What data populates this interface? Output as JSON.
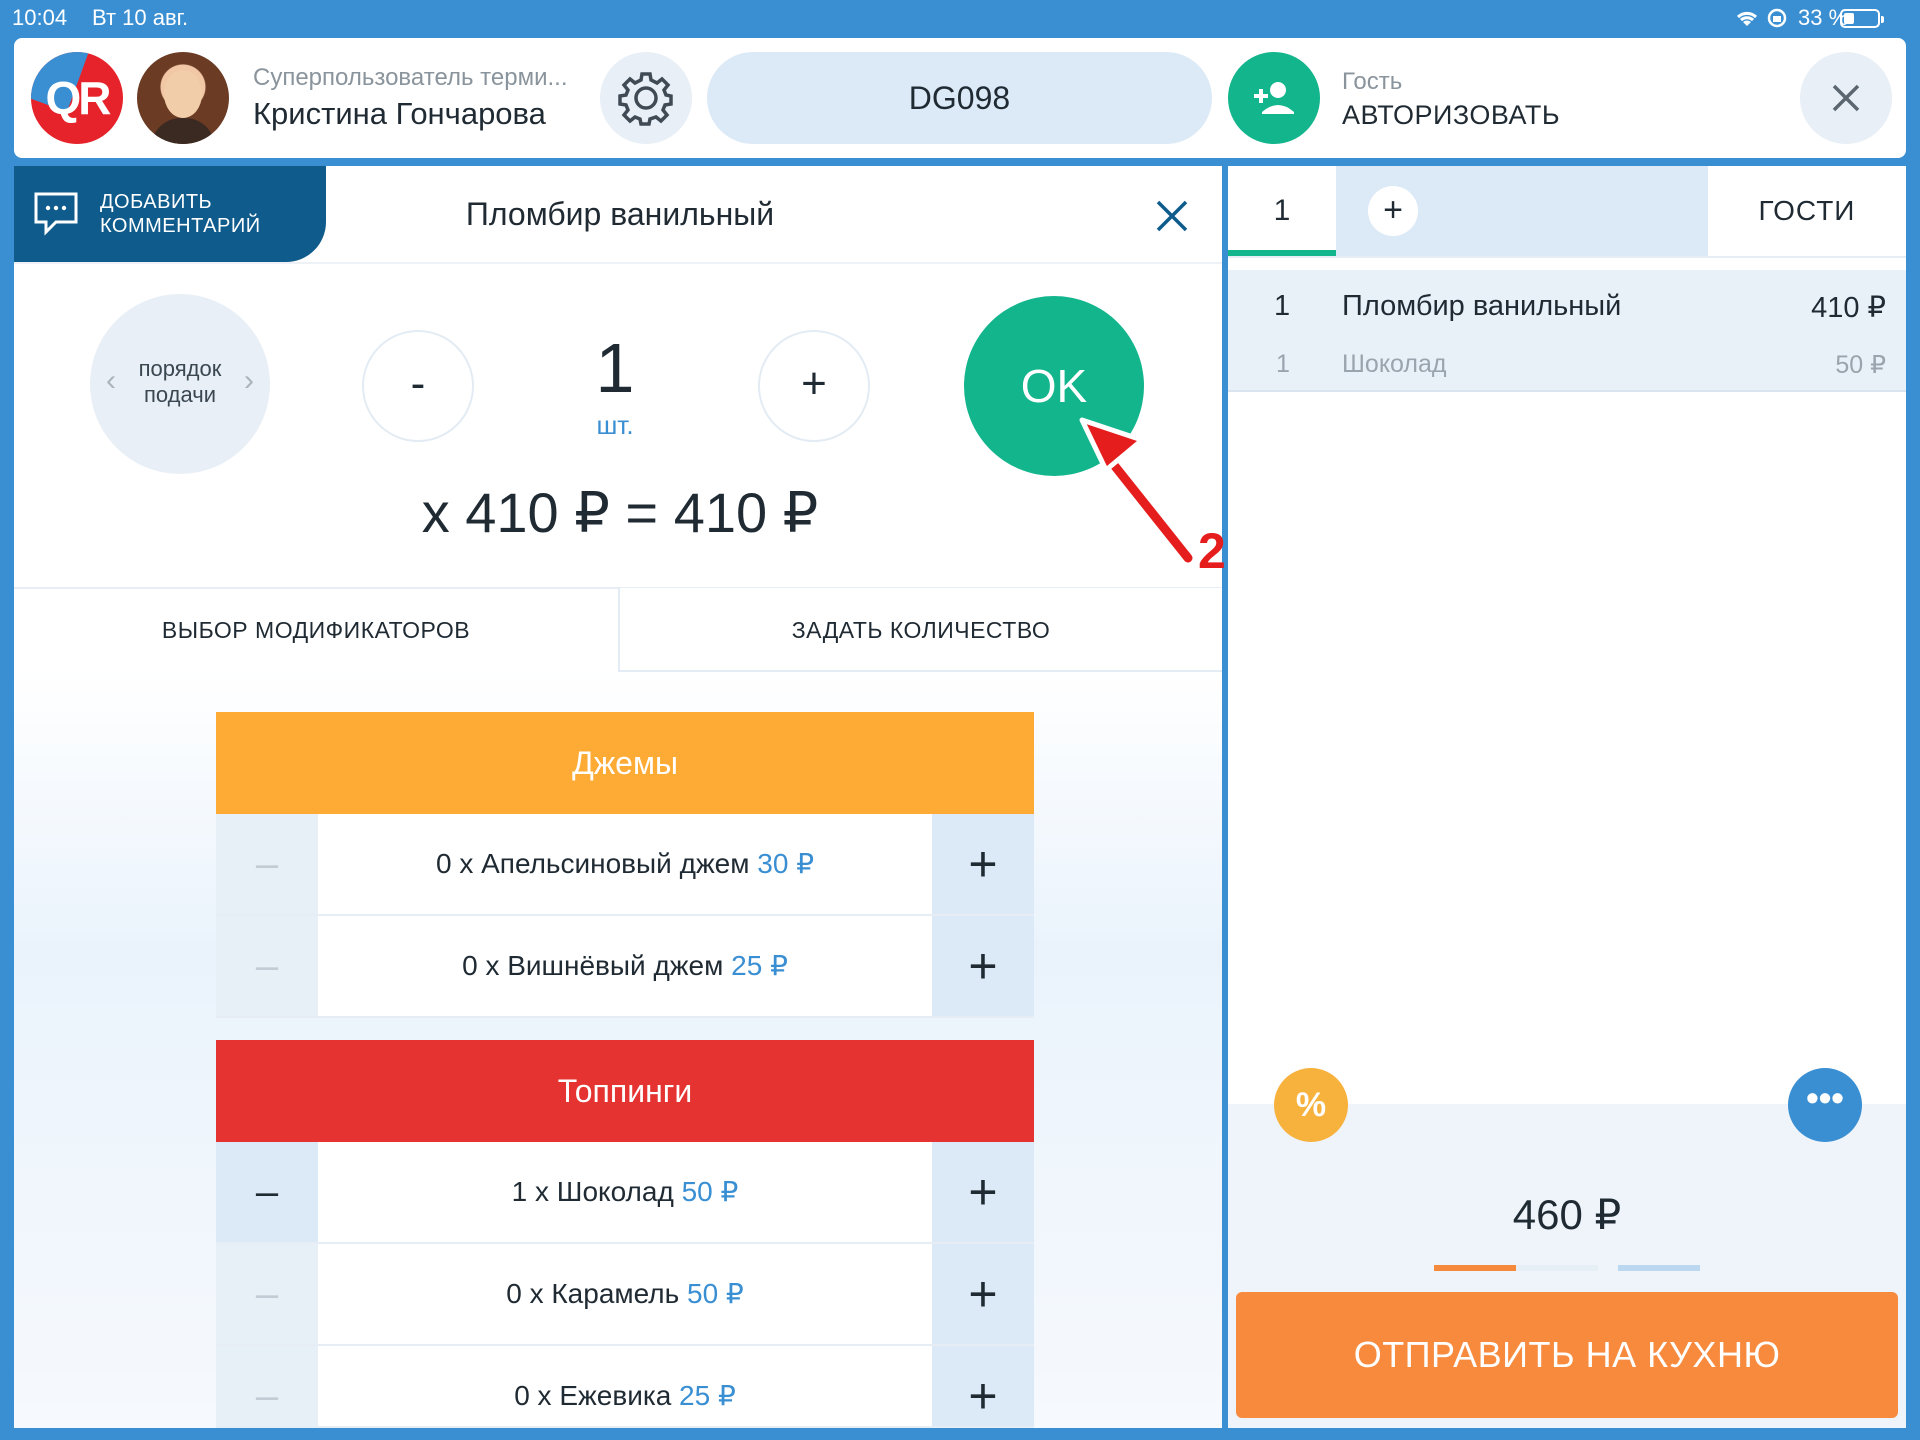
{
  "status": {
    "time": "10:04",
    "date": "Вт 10 авг.",
    "battery": "33 %"
  },
  "header": {
    "logo": "QR",
    "user_role": "Суперпользователь терми...",
    "user_name": "Кристина Гончарова",
    "order_code": "DG098",
    "guest_label": "Гость",
    "guest_action": "АВТОРИЗОВАТЬ",
    "icons": [
      "gear-icon",
      "add-user-icon",
      "close-icon"
    ]
  },
  "item": {
    "comment_label_1": "ДОБАВИТЬ",
    "comment_label_2": "КОММЕНТАРИЙ",
    "title": "Пломбир ванильный",
    "order_label_1": "порядок",
    "order_label_2": "подачи",
    "minus": "-",
    "plus": "+",
    "quantity": "1",
    "unit": "шт.",
    "ok": "OK",
    "price_line": "x 410 ₽ = 410 ₽"
  },
  "tabs": {
    "modifiers": "ВЫБОР МОДИФИКАТОРОВ",
    "set_qty": "ЗАДАТЬ КОЛИЧЕСТВО"
  },
  "groups": [
    {
      "name": "Джемы",
      "color": "#fdab35",
      "items": [
        {
          "text": "0 x Апельсиновый джем",
          "price": "30 ₽"
        },
        {
          "text": "0 x Вишнёвый джем",
          "price": "25 ₽"
        }
      ]
    },
    {
      "name": "Топпинги",
      "color": "#e43331",
      "items": [
        {
          "text": "1 x Шоколад",
          "price": "50 ₽"
        },
        {
          "text": "0 x Карамель",
          "price": "50 ₽"
        },
        {
          "text": "0 x Ежевика",
          "price": "25 ₽"
        }
      ]
    }
  ],
  "mod_buttons": {
    "minus_inactive": "–",
    "minus_active": "–",
    "plus": "+"
  },
  "order": {
    "tab_1": "1",
    "tab_add": "+",
    "tab_guests": "ГОСТИ",
    "lines": [
      {
        "qty": "1",
        "name": "Пломбир ванильный",
        "price": "410 ₽"
      },
      {
        "qty": "1",
        "name": "Шоколад",
        "price": "50 ₽"
      }
    ],
    "discount_icon": "%",
    "more_icon": "•••",
    "total": "460 ₽",
    "send": "ОТПРАВИТЬ НА КУХНЮ"
  },
  "annotation": {
    "number": "2"
  },
  "colors": {
    "accent_green": "#12b58c",
    "accent_blue": "#3a8fd3",
    "send_orange": "#f88a3e"
  }
}
